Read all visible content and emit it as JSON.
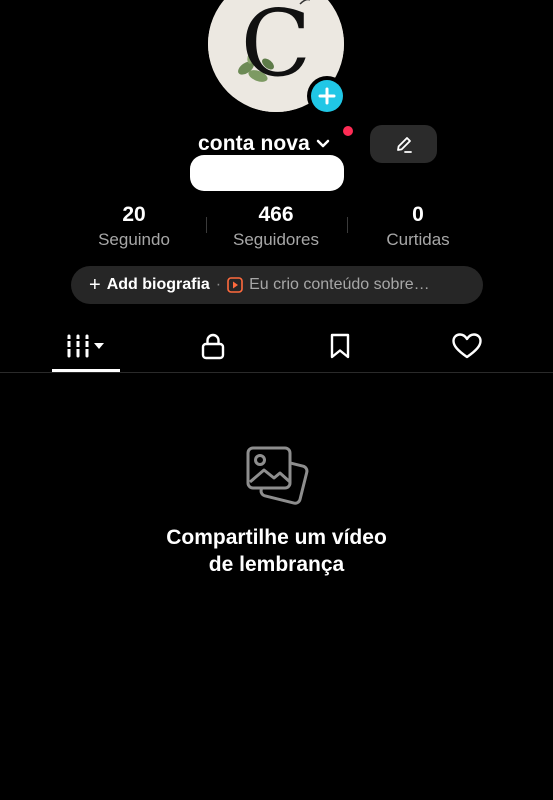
{
  "profile": {
    "username": "conta nova",
    "avatar_letter": "C"
  },
  "stats": [
    {
      "value": "20",
      "label": "Seguindo"
    },
    {
      "value": "466",
      "label": "Seguidores"
    },
    {
      "value": "0",
      "label": "Curtidas"
    }
  ],
  "bio": {
    "add_label": "Add biografia",
    "separator": "·",
    "hint": "Eu crio conteúdo sobre…"
  },
  "tabs": [
    {
      "name": "videos",
      "icon": "grid-icon",
      "active": true
    },
    {
      "name": "private",
      "icon": "lock-icon",
      "active": false
    },
    {
      "name": "saved",
      "icon": "bookmark-icon",
      "active": false
    },
    {
      "name": "liked",
      "icon": "heart-icon",
      "active": false
    }
  ],
  "empty_state": {
    "icon": "photos-icon",
    "line1": "Compartilhe um vídeo",
    "line2": "de lembrança"
  },
  "colors": {
    "background": "#000000",
    "accent_blue": "#20c7e6",
    "notification_red": "#fe2c55",
    "secondary_text": "#a7a7a7",
    "pill_background": "#262626"
  }
}
